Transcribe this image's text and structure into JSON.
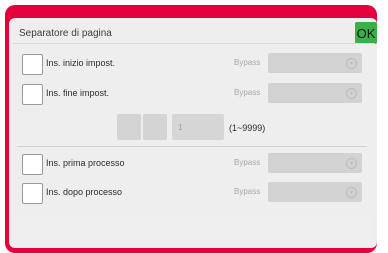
{
  "dialog": {
    "title": "Separatore di pagina",
    "ok_label": "OK",
    "accent": "#e4003a",
    "ok_color": "#3bb049"
  },
  "rows": [
    {
      "label": "Ins. inizio impost.",
      "tray_label": "Bypass",
      "checked": false
    },
    {
      "label": "Ins. fine impost.",
      "tray_label": "Bypass",
      "checked": false
    },
    {
      "label": "Ins. prima processo",
      "tray_label": "Bypass",
      "checked": false
    },
    {
      "label": "Ins. dopo processo",
      "tray_label": "Bypass",
      "checked": false
    }
  ],
  "counter": {
    "value": "1",
    "range": "(1~9999)"
  }
}
